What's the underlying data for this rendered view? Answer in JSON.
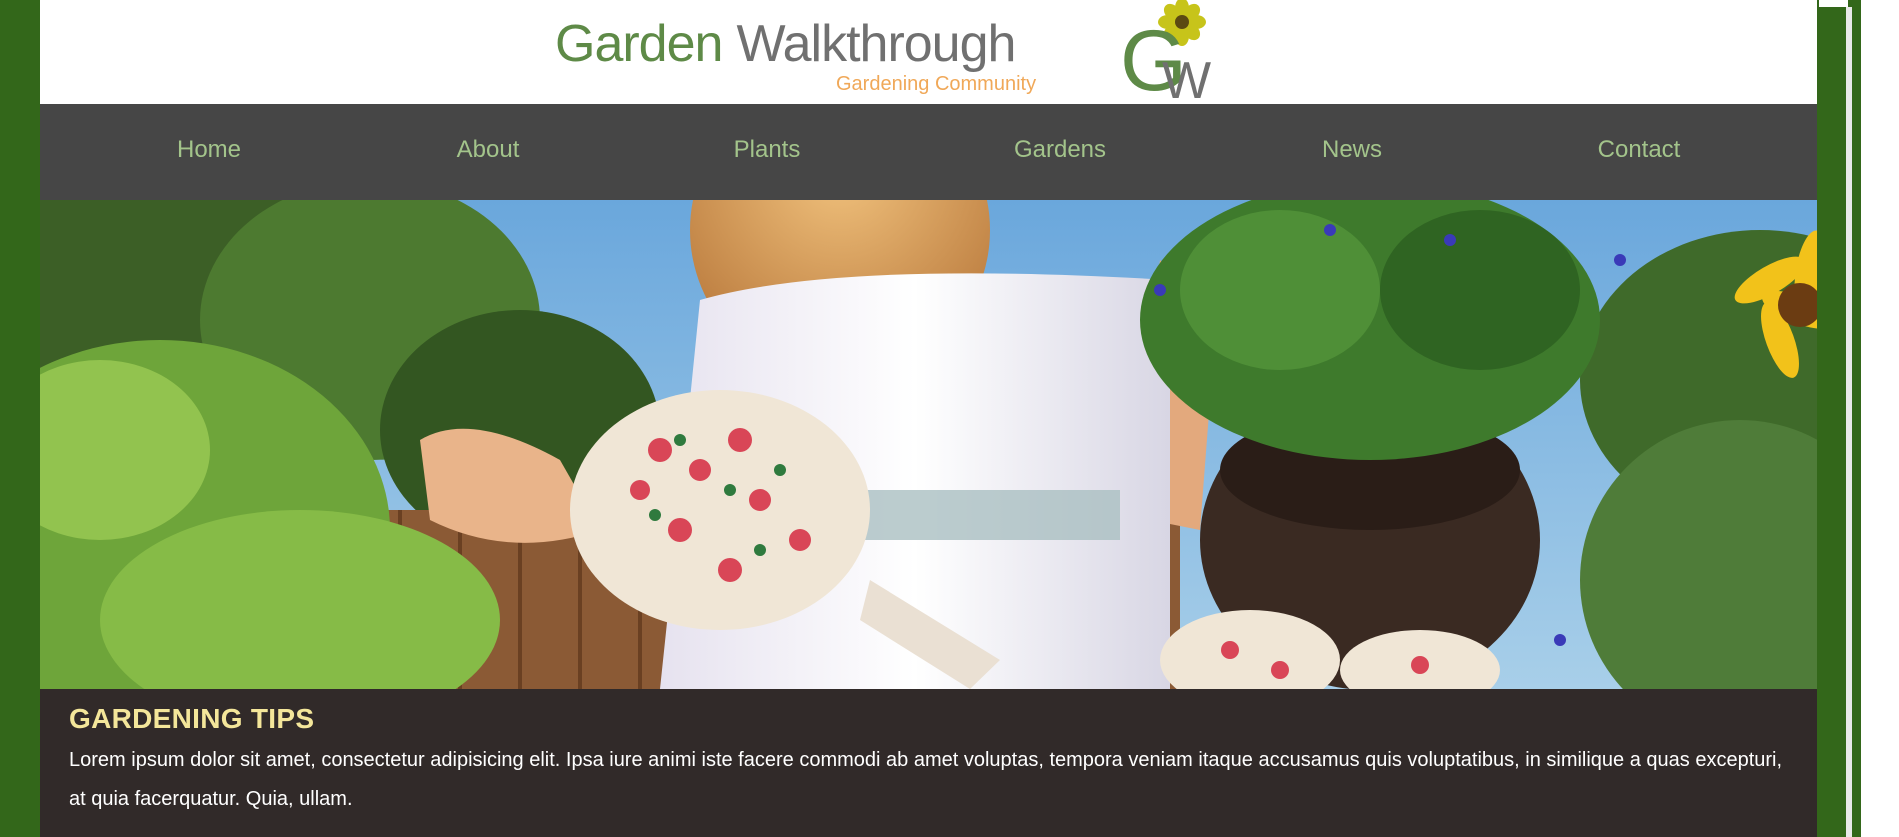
{
  "brand": {
    "title_part1": "Garden",
    "title_part2": "Walkthrough",
    "subtitle": "Gardening Community",
    "logo_letters": "GW"
  },
  "nav": {
    "items": [
      {
        "label": "Home"
      },
      {
        "label": "About"
      },
      {
        "label": "Plants"
      },
      {
        "label": "Gardens"
      },
      {
        "label": "News"
      },
      {
        "label": "Contact"
      }
    ]
  },
  "colors": {
    "background": "#33671a",
    "nav_bg": "#464646",
    "nav_text": "#a3c48b",
    "tips_bg": "#312a29",
    "tips_heading": "#f4e69a",
    "brand_green": "#5e8a47",
    "brand_gray": "#707070",
    "brand_orange": "#f0a858"
  },
  "hero": {
    "image": "woman-gardening-photo"
  },
  "tips": {
    "heading": "GARDENING TIPS",
    "body": "Lorem ipsum dolor sit amet, consectetur adipisicing elit. Ipsa iure animi iste facere commodi ab amet voluptas, tempora veniam itaque accusamus quis voluptatibus, in similique a quas excepturi, at quia facerquatur. Quia, ullam."
  }
}
